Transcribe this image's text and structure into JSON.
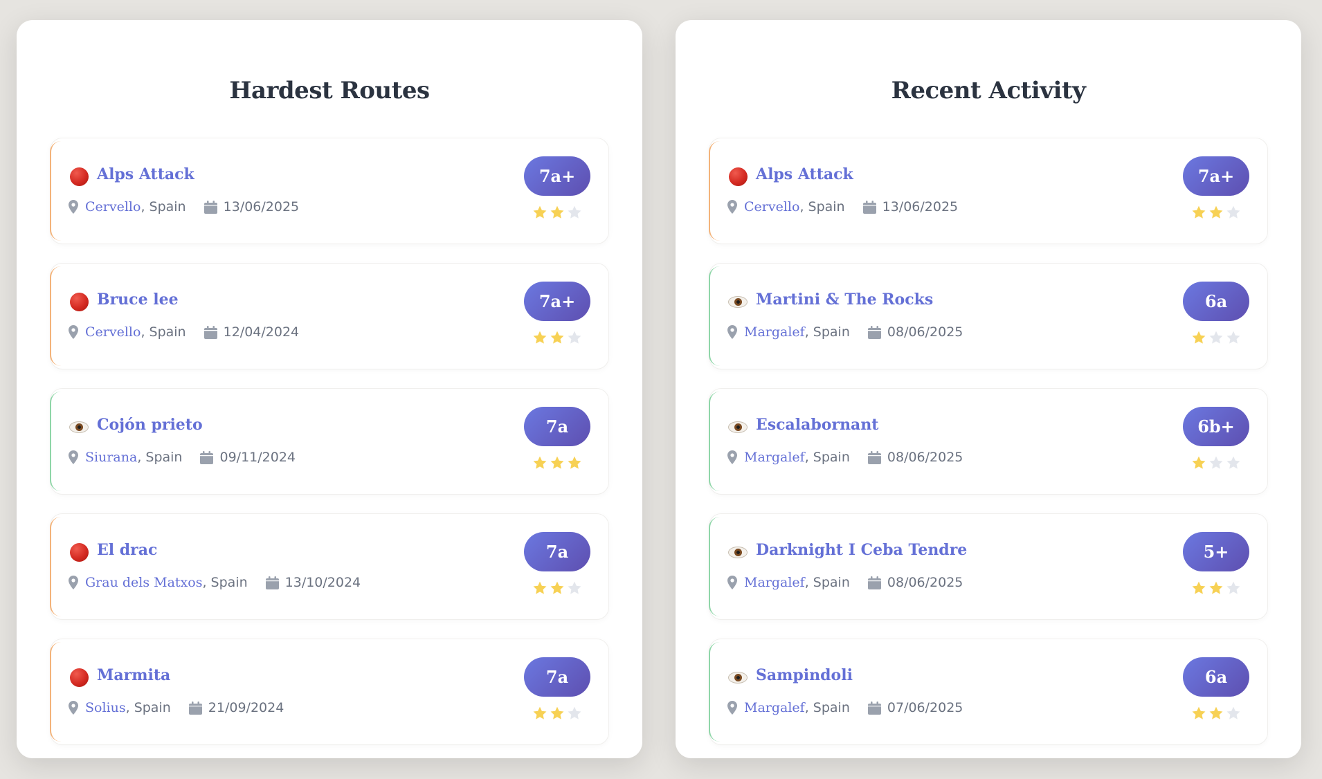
{
  "panels": [
    {
      "title": "Hardest Routes",
      "routes": [
        {
          "status": "red-dot-icon",
          "name": "Alps Attack",
          "crag": "Cervello",
          "country": ", Spain",
          "date": "13/06/2025",
          "grade": "7a+",
          "stars": 2,
          "accent": "#f3b37a"
        },
        {
          "status": "red-dot-icon",
          "name": "Bruce lee",
          "crag": "Cervello",
          "country": ", Spain",
          "date": "12/04/2024",
          "grade": "7a+",
          "stars": 2,
          "accent": "#f3b37a"
        },
        {
          "status": "eye-icon",
          "name": "Cojón prieto",
          "crag": "Siurana",
          "country": ", Spain",
          "date": "09/11/2024",
          "grade": "7a",
          "stars": 3,
          "accent": "#8fd6a8"
        },
        {
          "status": "red-dot-icon",
          "name": "El drac",
          "crag": "Grau dels Matxos",
          "country": ", Spain",
          "date": "13/10/2024",
          "grade": "7a",
          "stars": 2,
          "accent": "#f3b37a"
        },
        {
          "status": "red-dot-icon",
          "name": "Marmita",
          "crag": "Solius",
          "country": ", Spain",
          "date": "21/09/2024",
          "grade": "7a",
          "stars": 2,
          "accent": "#f3b37a"
        }
      ]
    },
    {
      "title": "Recent Activity",
      "routes": [
        {
          "status": "red-dot-icon",
          "name": "Alps Attack",
          "crag": "Cervello",
          "country": ", Spain",
          "date": "13/06/2025",
          "grade": "7a+",
          "stars": 2,
          "accent": "#f3b37a"
        },
        {
          "status": "eye-icon",
          "name": "Martini & The Rocks",
          "crag": "Margalef",
          "country": ", Spain",
          "date": "08/06/2025",
          "grade": "6a",
          "stars": 1,
          "accent": "#8fd6a8"
        },
        {
          "status": "eye-icon",
          "name": "Escalabornant",
          "crag": "Margalef",
          "country": ", Spain",
          "date": "08/06/2025",
          "grade": "6b+",
          "stars": 1,
          "accent": "#8fd6a8"
        },
        {
          "status": "eye-icon",
          "name": "Darknight I Ceba Tendre",
          "crag": "Margalef",
          "country": ", Spain",
          "date": "08/06/2025",
          "grade": "5+",
          "stars": 2,
          "accent": "#8fd6a8"
        },
        {
          "status": "eye-icon",
          "name": "Sampindoli",
          "crag": "Margalef",
          "country": ", Spain",
          "date": "07/06/2025",
          "grade": "6a",
          "stars": 2,
          "accent": "#8fd6a8"
        }
      ]
    }
  ],
  "colors": {
    "star_filled": "#f7d154",
    "star_empty": "#e3e6ec",
    "link": "#6470d6",
    "meta": "#6b7280"
  },
  "max_stars": 3
}
